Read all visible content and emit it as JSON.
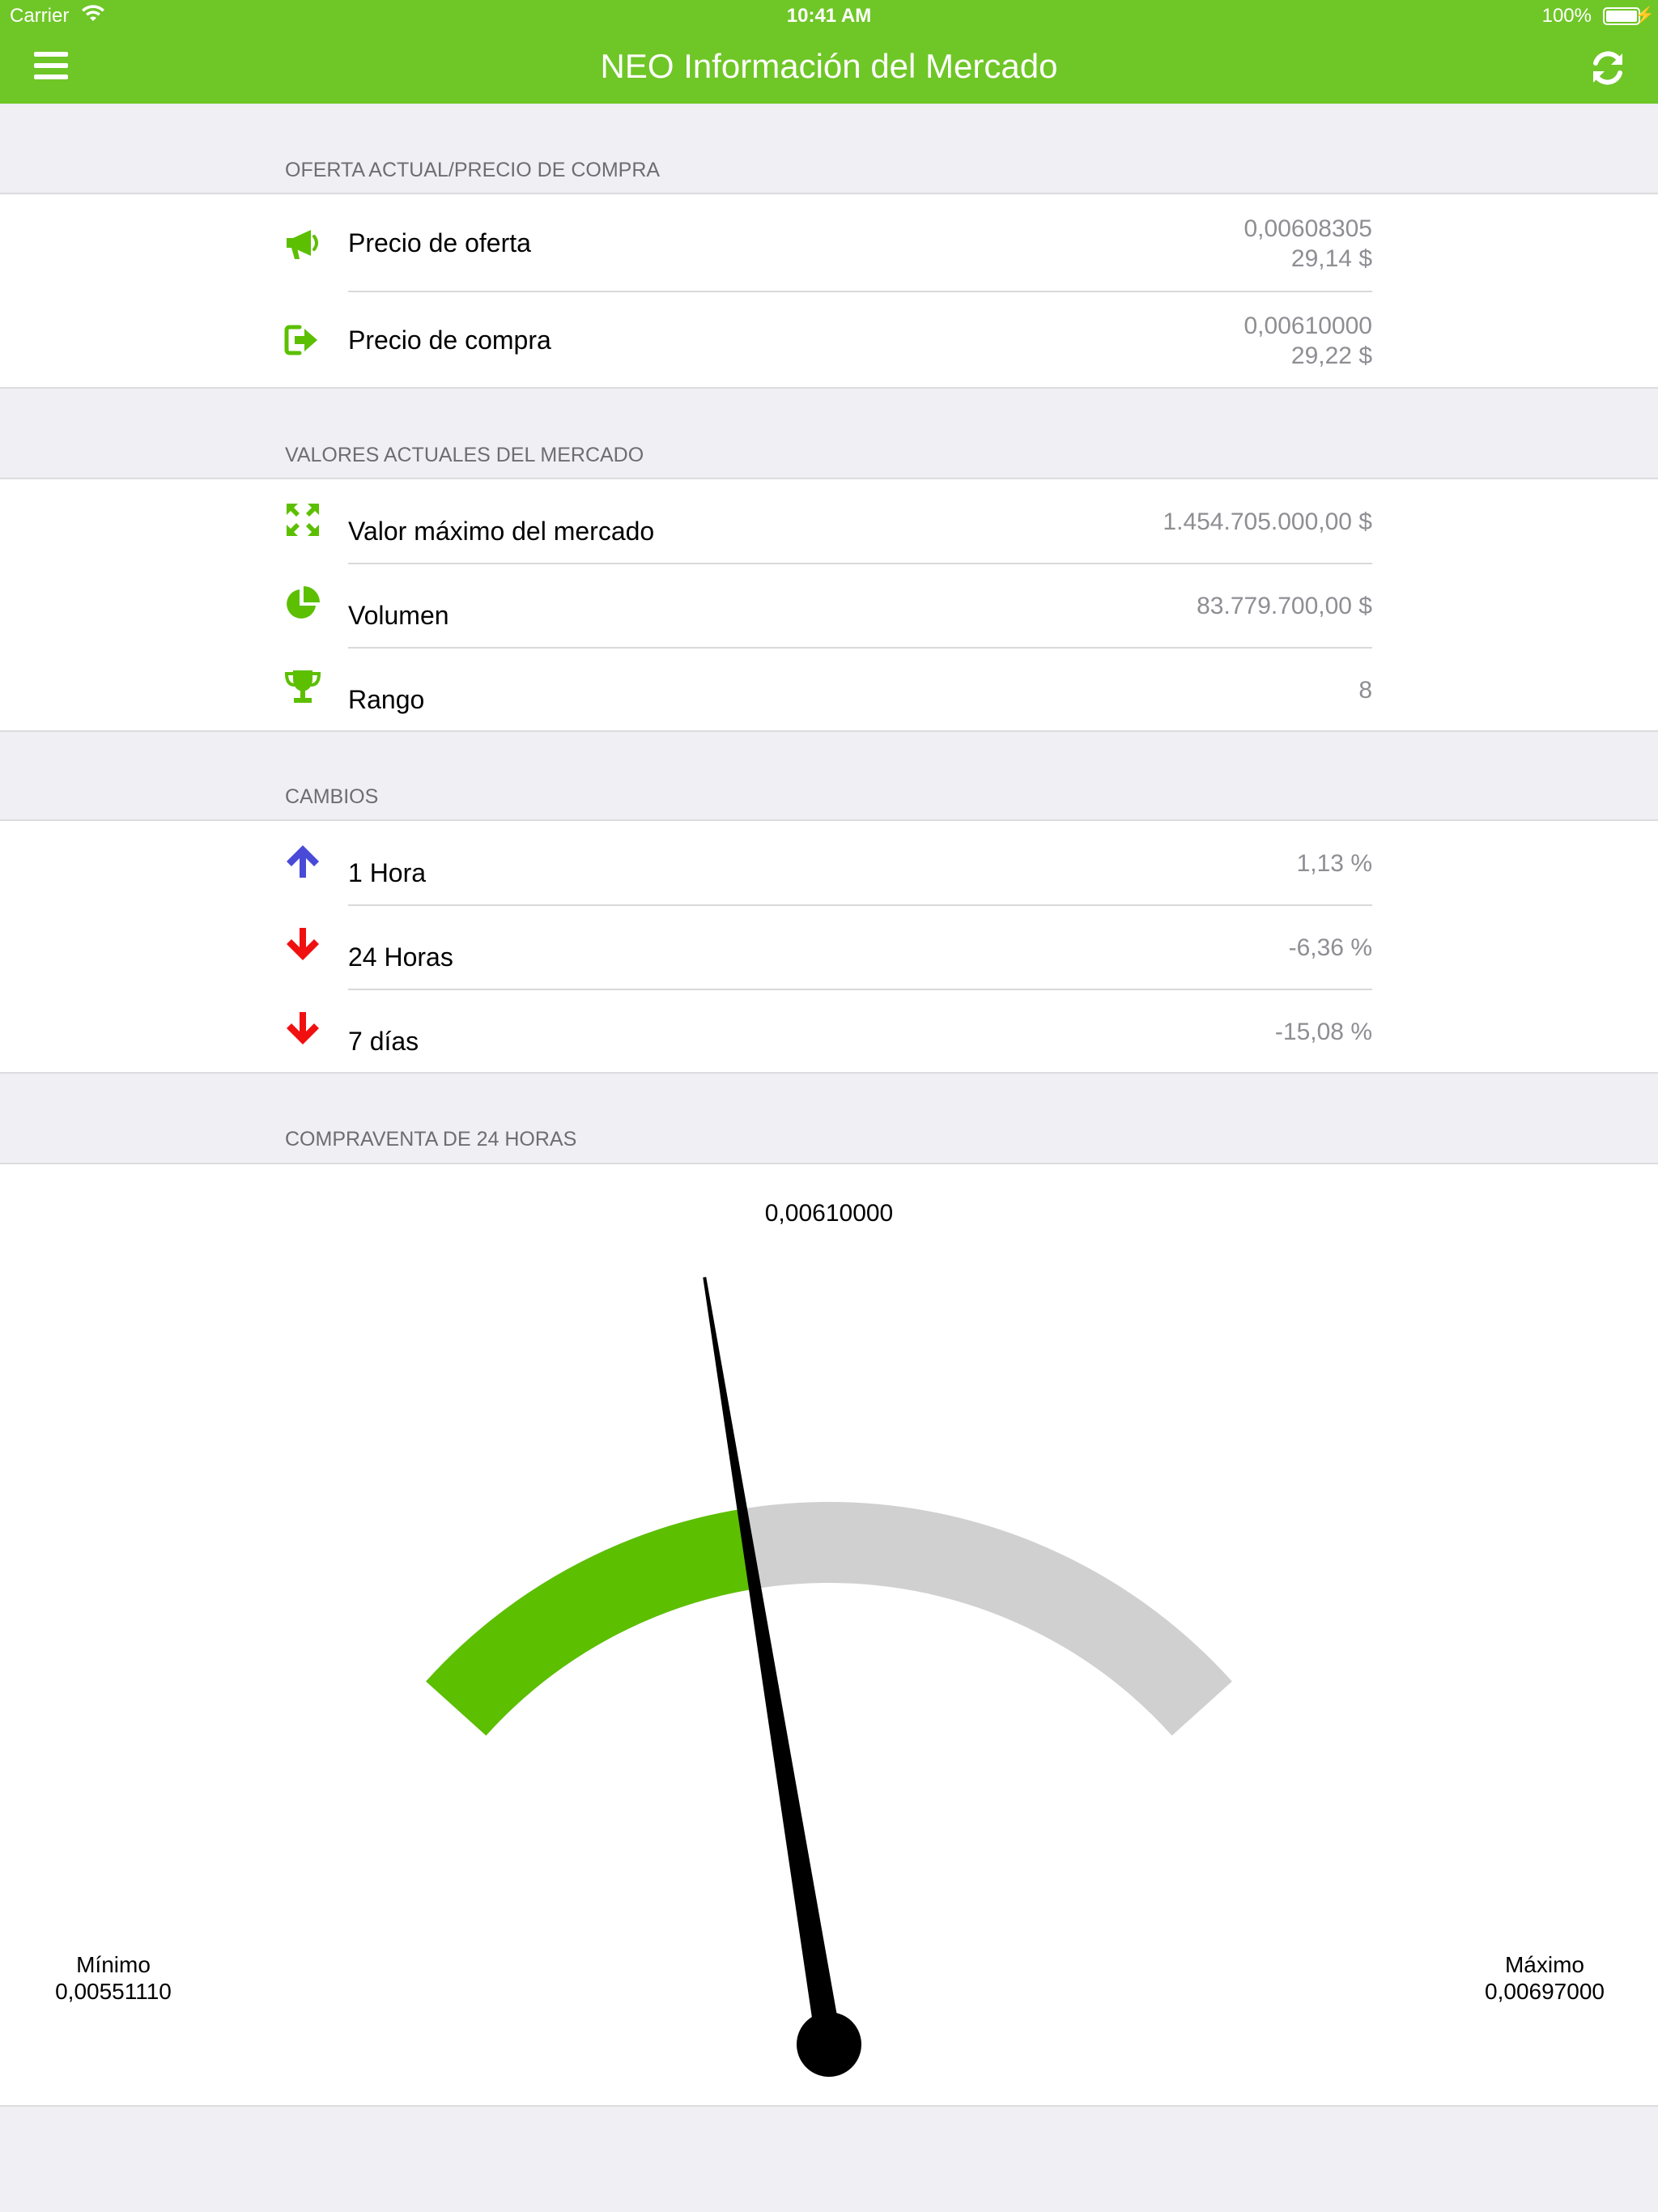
{
  "status_bar": {
    "carrier": "Carrier",
    "time": "10:41 AM",
    "battery": "100%"
  },
  "header": {
    "title": "NEO Información del Mercado"
  },
  "colors": {
    "brand": "#6fc627",
    "icon_green": "#5cbf00",
    "up_blue": "#4a4ad8",
    "down_red": "#f01010",
    "gauge_track": "#d0d0d0",
    "gauge_fill": "#5cbf00"
  },
  "sections": {
    "offer": {
      "header": "OFERTA ACTUAL/PRECIO DE COMPRA",
      "rows": [
        {
          "label": "Precio de oferta",
          "value1": "0,00608305",
          "value2": "29,14 $",
          "icon": "megaphone-icon"
        },
        {
          "label": "Precio de compra",
          "value1": "0,00610000",
          "value2": "29,22 $",
          "icon": "sign-in-icon"
        }
      ]
    },
    "market": {
      "header": "VALORES ACTUALES DEL MERCADO",
      "rows": [
        {
          "label": "Valor máximo del mercado",
          "value": "1.454.705.000,00 $",
          "icon": "expand-arrows-icon"
        },
        {
          "label": "Volumen",
          "value": "83.779.700,00 $",
          "icon": "pie-chart-icon"
        },
        {
          "label": "Rango",
          "value": "8",
          "icon": "trophy-icon"
        }
      ]
    },
    "changes": {
      "header": "CAMBIOS",
      "rows": [
        {
          "label": "1 Hora",
          "value": "1,13 %",
          "icon": "arrow-up-icon"
        },
        {
          "label": "24 Horas",
          "value": "-6,36 %",
          "icon": "arrow-down-icon"
        },
        {
          "label": "7 días",
          "value": "-15,08 %",
          "icon": "arrow-down-icon"
        }
      ]
    },
    "gauge": {
      "header": "COMPRAVENTA DE 24 HORAS",
      "current_value": "0,00610000",
      "min_label": "Mínimo",
      "min_value": "0,00551110",
      "max_label": "Máximo",
      "max_value": "0,00697000",
      "fraction": 0.404
    }
  }
}
